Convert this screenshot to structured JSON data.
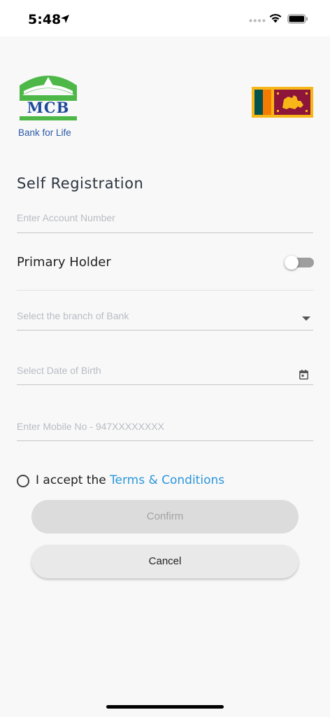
{
  "status_bar": {
    "time": "5:48",
    "icons": [
      "location-arrow-icon",
      "signal-dots-icon",
      "wifi-icon",
      "battery-icon"
    ]
  },
  "branding": {
    "logo_text": "MCB",
    "tagline": "Bank for Life",
    "flag_icon": "sri-lanka-flag-icon",
    "colors": {
      "logo_green": "#4db848",
      "logo_blue": "#1e4a9a"
    }
  },
  "form": {
    "title": "Self Registration",
    "account_number": {
      "placeholder": "Enter Account Number",
      "value": ""
    },
    "primary_holder": {
      "label": "Primary Holder",
      "enabled": false
    },
    "branch": {
      "placeholder": "Select the branch of Bank",
      "icon": "dropdown-arrow-icon"
    },
    "date_of_birth": {
      "placeholder": "Select Date of Birth",
      "icon": "calendar-icon"
    },
    "mobile": {
      "placeholder": "Enter Mobile No - 947XXXXXXXX",
      "value": ""
    },
    "terms": {
      "prefix": "I accept the",
      "link": "Terms & Conditions",
      "checked": false,
      "link_color": "#2a96d9"
    }
  },
  "buttons": {
    "confirm": "Confirm",
    "cancel": "Cancel"
  }
}
